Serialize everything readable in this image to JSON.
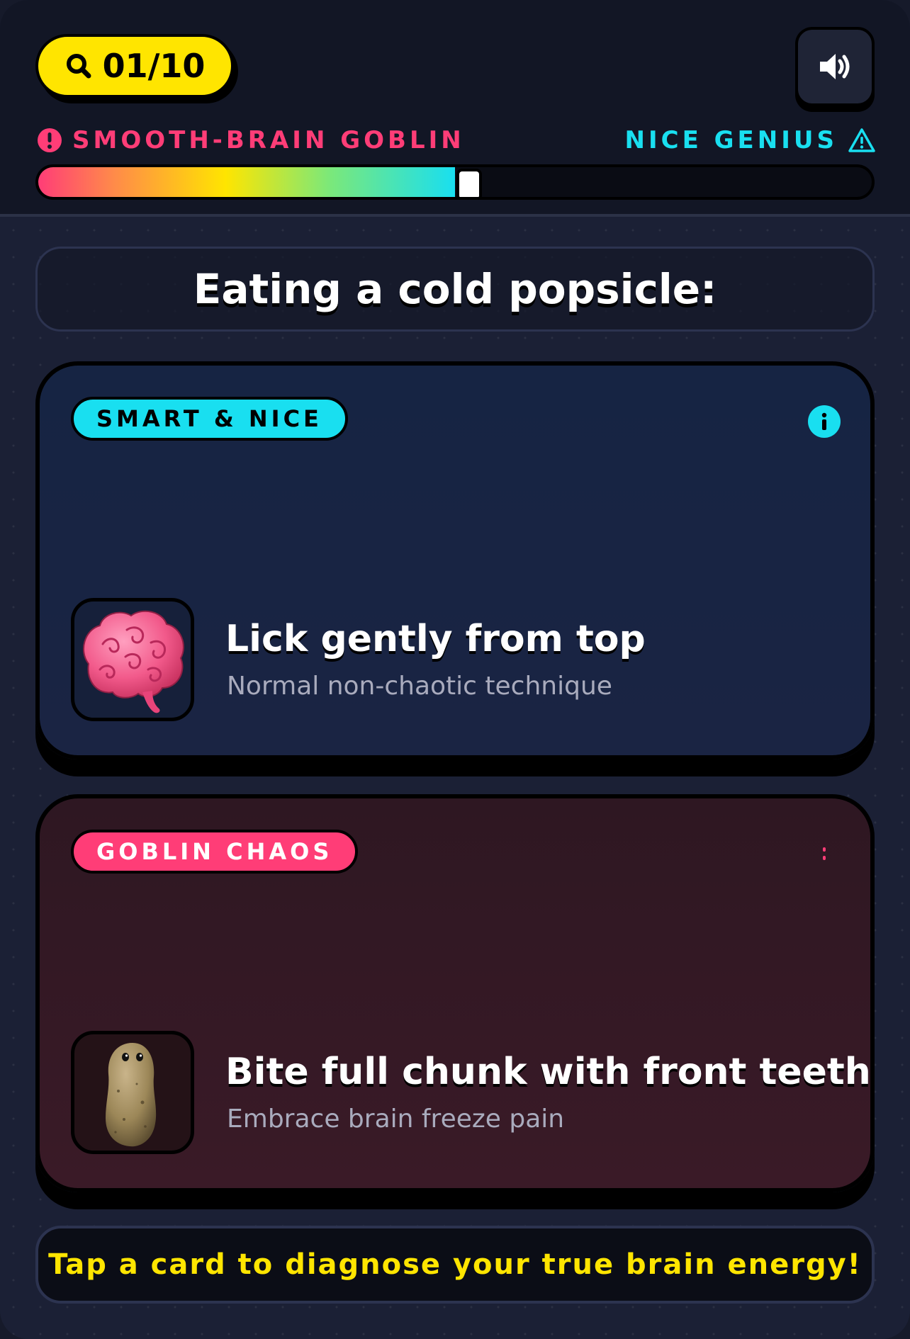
{
  "header": {
    "question_counter": "01/10",
    "question_current": 1,
    "question_total": 10,
    "sound_button": "speaker-icon"
  },
  "scale": {
    "left_label": "SMOOTH-BRAIN GOBLIN",
    "right_label": "NICE GENIUS",
    "meter_percent": 50
  },
  "question": {
    "text": "Eating a cold popsicle:"
  },
  "cards": [
    {
      "badge": "SMART & NICE",
      "title": "Lick gently from top",
      "subtitle": "Normal non-chaotic technique",
      "image": "brain-icon",
      "accent": "#19dff0"
    },
    {
      "badge": "GOBLIN CHAOS",
      "title": "Bite full chunk with front teeth",
      "subtitle": "Embrace brain freeze pain",
      "image": "potato-icon",
      "accent": "#ff3d77"
    }
  ],
  "footer": {
    "hint": "Tap a card to diagnose your true brain energy!"
  },
  "colors": {
    "yellow": "#ffe500",
    "pink": "#ff3d77",
    "cyan": "#19dff0",
    "background": "#1b2035"
  }
}
